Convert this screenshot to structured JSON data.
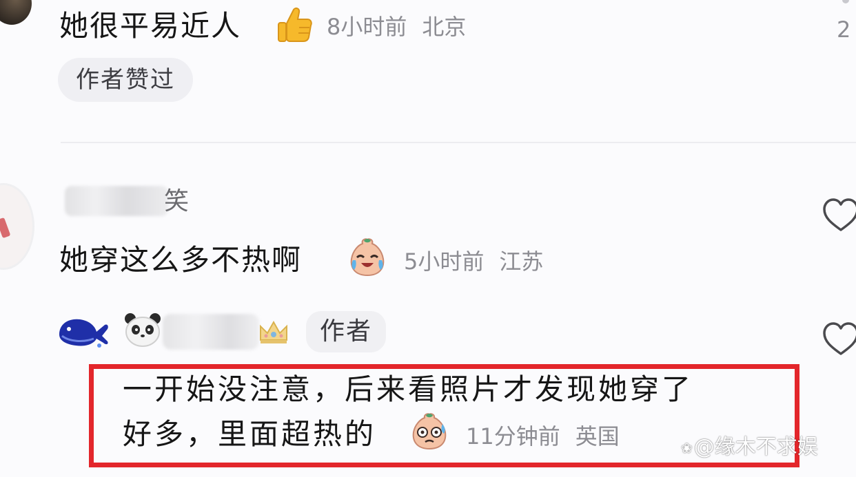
{
  "comments": [
    {
      "text": "她很平易近人",
      "emoji": "thumbs-up",
      "time": "8小时前",
      "location": "北京",
      "badge": "作者赞过",
      "edge_count": "2"
    },
    {
      "username_prefix": "",
      "username_suffix": "笑",
      "text": "她穿这么多不热啊",
      "emoji": "crying-laughing",
      "time": "5小时前",
      "location": "江苏"
    }
  ],
  "reply": {
    "author_badge": "作者",
    "line1": "一开始没注意，后来看照片才发现她穿了",
    "line2": "好多，里面超热的",
    "emoji": "sweating",
    "time": "11分钟前",
    "location": "英国"
  },
  "watermark": {
    "text": "@缘木不求娱"
  },
  "colors": {
    "highlight_border": "#e3262b",
    "meta_text": "#8c8c92",
    "badge_bg": "#efeff3"
  }
}
